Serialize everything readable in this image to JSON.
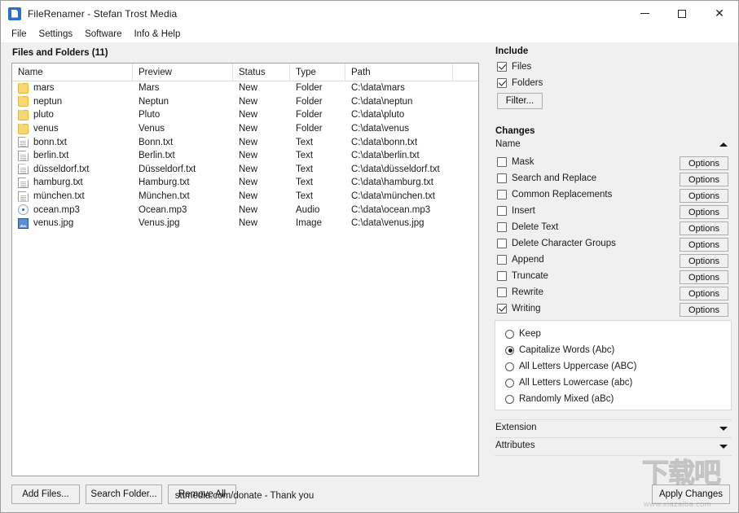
{
  "window": {
    "title": "FileRenamer - Stefan Trost Media",
    "app_icon": "document-icon",
    "minimize_label": "—",
    "maximize_label": "□",
    "close_label": "✕"
  },
  "menubar": {
    "items": [
      {
        "label": "File"
      },
      {
        "label": "Settings"
      },
      {
        "label": "Software"
      },
      {
        "label": "Info & Help"
      }
    ]
  },
  "left": {
    "caption": "Files and Folders (11)",
    "columns": [
      "Name",
      "Preview",
      "Status",
      "Type",
      "Path"
    ],
    "rows": [
      {
        "icon": "folder-icon",
        "name": "mars",
        "preview": "Mars",
        "status": "New",
        "type": "Folder",
        "path": "C:\\data\\mars"
      },
      {
        "icon": "folder-icon",
        "name": "neptun",
        "preview": "Neptun",
        "status": "New",
        "type": "Folder",
        "path": "C:\\data\\neptun"
      },
      {
        "icon": "folder-icon",
        "name": "pluto",
        "preview": "Pluto",
        "status": "New",
        "type": "Folder",
        "path": "C:\\data\\pluto"
      },
      {
        "icon": "folder-icon",
        "name": "venus",
        "preview": "Venus",
        "status": "New",
        "type": "Folder",
        "path": "C:\\data\\venus"
      },
      {
        "icon": "text-file-icon",
        "name": "bonn.txt",
        "preview": "Bonn.txt",
        "status": "New",
        "type": "Text",
        "path": "C:\\data\\bonn.txt"
      },
      {
        "icon": "text-file-icon",
        "name": "berlin.txt",
        "preview": "Berlin.txt",
        "status": "New",
        "type": "Text",
        "path": "C:\\data\\berlin.txt"
      },
      {
        "icon": "text-file-icon",
        "name": "düsseldorf.txt",
        "preview": "Düsseldorf.txt",
        "status": "New",
        "type": "Text",
        "path": "C:\\data\\düsseldorf.txt"
      },
      {
        "icon": "text-file-icon",
        "name": "hamburg.txt",
        "preview": "Hamburg.txt",
        "status": "New",
        "type": "Text",
        "path": "C:\\data\\hamburg.txt"
      },
      {
        "icon": "text-file-icon",
        "name": "münchen.txt",
        "preview": "München.txt",
        "status": "New",
        "type": "Text",
        "path": "C:\\data\\münchen.txt"
      },
      {
        "icon": "audio-file-icon",
        "name": "ocean.mp3",
        "preview": "Ocean.mp3",
        "status": "New",
        "type": "Audio",
        "path": "C:\\data\\ocean.mp3"
      },
      {
        "icon": "image-file-icon",
        "name": "venus.jpg",
        "preview": "Venus.jpg",
        "status": "New",
        "type": "Image",
        "path": "C:\\data\\venus.jpg"
      }
    ],
    "buttons": {
      "add_files": "Add Files...",
      "search_folder": "Search Folder...",
      "remove_all": "Remove All"
    },
    "donate": "sttmedia.com/donate - Thank you"
  },
  "right": {
    "include": {
      "title": "Include",
      "files": {
        "label": "Files",
        "checked": true
      },
      "folders": {
        "label": "Folders",
        "checked": true
      },
      "filter_button": "Filter..."
    },
    "changes": {
      "title": "Changes",
      "name_group": {
        "label": "Name",
        "expanded": true,
        "chevron": "chevron-up-icon"
      },
      "options_label": "Options",
      "items": [
        {
          "label": "Mask",
          "checked": false
        },
        {
          "label": "Search and Replace",
          "checked": false
        },
        {
          "label": "Common Replacements",
          "checked": false
        },
        {
          "label": "Insert",
          "checked": false
        },
        {
          "label": "Delete Text",
          "checked": false
        },
        {
          "label": "Delete Character Groups",
          "checked": false
        },
        {
          "label": "Append",
          "checked": false
        },
        {
          "label": "Truncate",
          "checked": false
        },
        {
          "label": "Rewrite",
          "checked": false
        },
        {
          "label": "Writing",
          "checked": true
        }
      ]
    },
    "writing_options": [
      {
        "label": "Keep",
        "selected": false
      },
      {
        "label": "Capitalize Words (Abc)",
        "selected": true
      },
      {
        "label": "All Letters Uppercase (ABC)",
        "selected": false
      },
      {
        "label": "All Letters Lowercase (abc)",
        "selected": false
      },
      {
        "label": "Randomly Mixed (aBc)",
        "selected": false
      }
    ],
    "collapsed_sections": [
      {
        "label": "Extension",
        "chevron": "chevron-down-icon"
      },
      {
        "label": "Attributes",
        "chevron": "chevron-down-icon"
      }
    ],
    "apply_button": "Apply Changes"
  },
  "watermark": {
    "text_cn": "下载吧",
    "url": "www.xiazaiba.com"
  },
  "colors": {
    "window_bg": "#f0f0f0",
    "list_bg": "#ffffff",
    "folder_icon": "#f7d774",
    "accent": "#0078d7",
    "text": "#1a1a1a"
  }
}
